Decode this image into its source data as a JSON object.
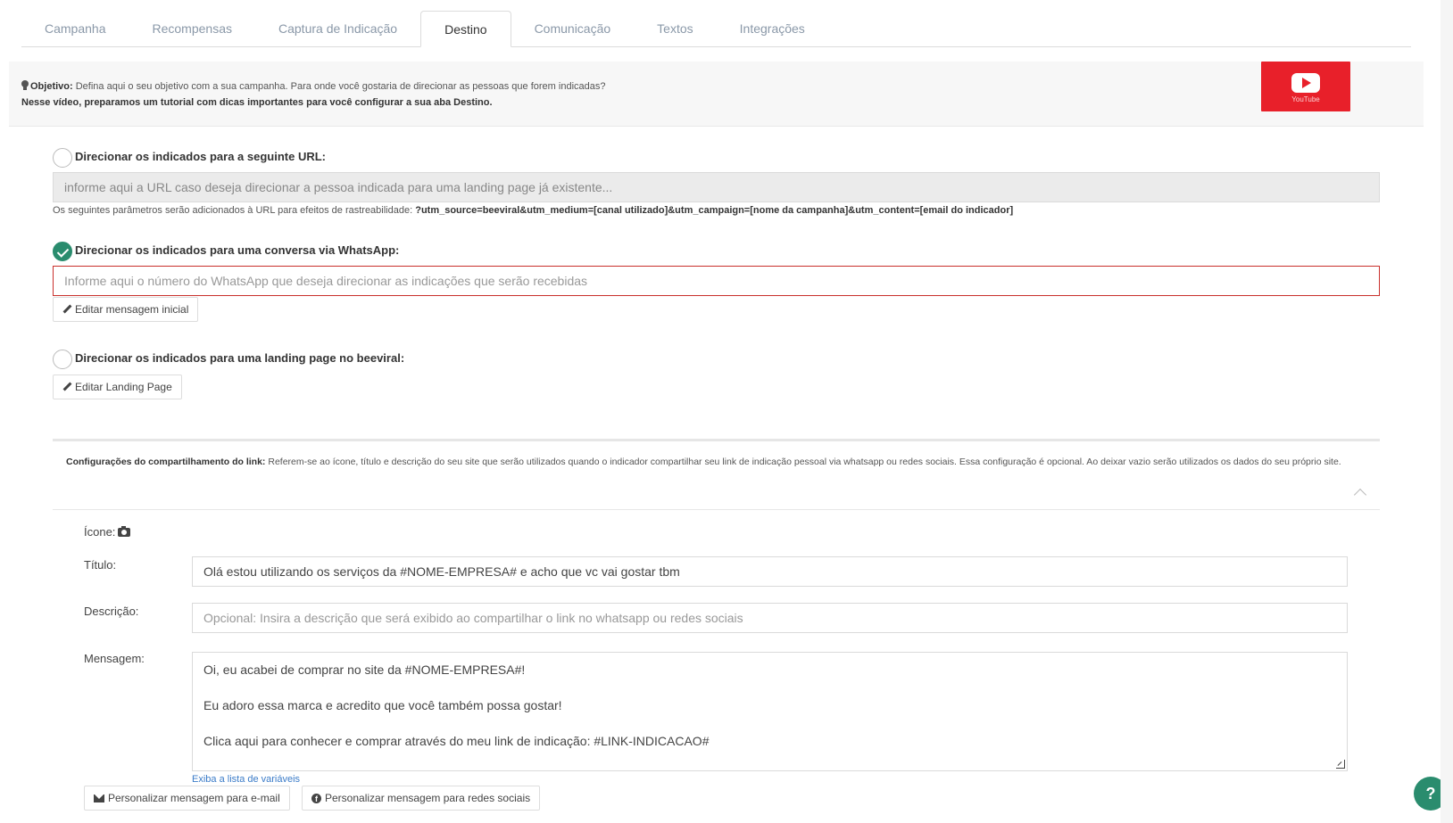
{
  "tabs": [
    {
      "label": "Campanha"
    },
    {
      "label": "Recompensas"
    },
    {
      "label": "Captura de Indicação"
    },
    {
      "label": "Destino"
    },
    {
      "label": "Comunicação"
    },
    {
      "label": "Textos"
    },
    {
      "label": "Integrações"
    }
  ],
  "active_tab": "Destino",
  "banner": {
    "objective_label": "Objetivo:",
    "objective_text": " Defina aqui o seu objetivo com a sua campanha. Para onde você gostaria de direcionar as pessoas que forem indicadas?",
    "video_text": "Nesse vídeo, preparamos um tutorial com dicas importantes para você configurar a sua aba Destino.",
    "youtube_label": "YouTube"
  },
  "options": {
    "url": {
      "label": "Direcionar os indicados para a seguinte URL:",
      "placeholder": "informe aqui a URL caso deseja direcionar a pessoa indicada para uma landing page já existente...",
      "checked": false,
      "hint_prefix": "Os seguintes parâmetros serão adicionados à URL para efeitos de rastreabilidade: ",
      "hint_params": "?utm_source=beeviral&utm_medium=[canal utilizado]&utm_campaign=[nome da campanha]&utm_content=[email do indicador]"
    },
    "whatsapp": {
      "label": "Direcionar os indicados para uma conversa via WhatsApp:",
      "placeholder": "Informe aqui o número do WhatsApp que deseja direcionar as indicações que serão recebidas",
      "checked": true,
      "button_label": "Editar mensagem inicial"
    },
    "landing": {
      "label": "Direcionar os indicados para uma landing page no beeviral:",
      "checked": false,
      "button_label": "Editar Landing Page"
    }
  },
  "share_config": {
    "title": "Configurações do compartilhamento do link:",
    "description": " Referem-se ao ícone, título e descrição do seu site que serão utilizados quando o indicador compartilhar seu link de indicação pessoal via whatsapp ou redes sociais. Essa configuração é opcional. Ao deixar vazio serão utilizados os dados do seu próprio site.",
    "icon_label": "Ícone:",
    "title_label": "Título:",
    "title_value": "Olá estou utilizando os serviços da #NOME-EMPRESA# e acho que vc vai gostar tbm",
    "description_label": "Descrição:",
    "description_placeholder": "Opcional: Insira a descrição que será exibido ao compartilhar o link no whatsapp ou redes sociais",
    "message_label": "Mensagem:",
    "message_lines": [
      "Oi, eu acabei de comprar no site da #NOME-EMPRESA#!",
      "Eu adoro essa marca e acredito que você também possa gostar!",
      "Clica aqui para conhecer e comprar através do meu link de indicação: #LINK-INDICACAO#"
    ],
    "variables_link": "Exiba a lista de variáveis",
    "email_button": "Personalizar mensagem para e-mail",
    "social_button": "Personalizar mensagem para redes sociais"
  },
  "help_label": "?",
  "colors": {
    "accent_green": "#2a8c6e",
    "error_red": "#c9302c",
    "youtube_red": "#e8202a",
    "link_blue": "#3a7bc8"
  }
}
